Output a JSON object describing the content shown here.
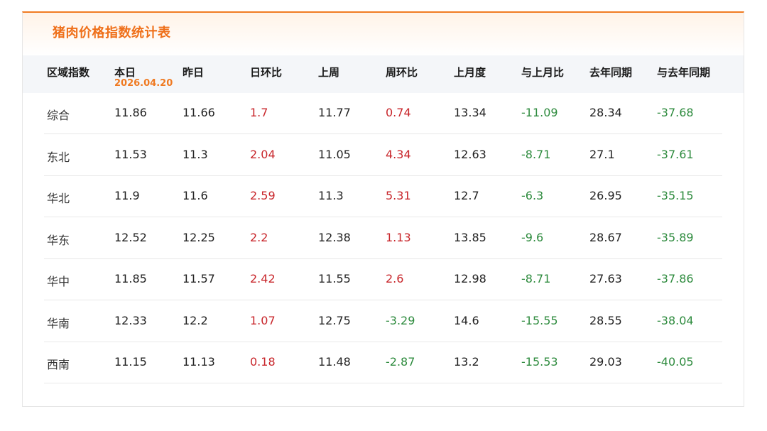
{
  "title": "猪肉价格指数统计表",
  "header": {
    "region": "区域指数",
    "today": "本日",
    "today_date": "2026.04.20",
    "yesterday": "昨日",
    "day_ratio": "日环比",
    "last_week": "上周",
    "week_ratio": "周环比",
    "last_month": "上月度",
    "month_ratio": "与上月比",
    "last_year": "去年同期",
    "year_ratio": "与去年同期"
  },
  "rows": [
    {
      "region": "综合",
      "today": "11.86",
      "yesterday": "11.66",
      "day_ratio": "1.7",
      "last_week": "11.77",
      "week_ratio": "0.74",
      "last_month": "13.34",
      "month_ratio": "-11.09",
      "last_year": "28.34",
      "year_ratio": "-37.68"
    },
    {
      "region": "东北",
      "today": "11.53",
      "yesterday": "11.3",
      "day_ratio": "2.04",
      "last_week": "11.05",
      "week_ratio": "4.34",
      "last_month": "12.63",
      "month_ratio": "-8.71",
      "last_year": "27.1",
      "year_ratio": "-37.61"
    },
    {
      "region": "华北",
      "today": "11.9",
      "yesterday": "11.6",
      "day_ratio": "2.59",
      "last_week": "11.3",
      "week_ratio": "5.31",
      "last_month": "12.7",
      "month_ratio": "-6.3",
      "last_year": "26.95",
      "year_ratio": "-35.15"
    },
    {
      "region": "华东",
      "today": "12.52",
      "yesterday": "12.25",
      "day_ratio": "2.2",
      "last_week": "12.38",
      "week_ratio": "1.13",
      "last_month": "13.85",
      "month_ratio": "-9.6",
      "last_year": "28.67",
      "year_ratio": "-35.89"
    },
    {
      "region": "华中",
      "today": "11.85",
      "yesterday": "11.57",
      "day_ratio": "2.42",
      "last_week": "11.55",
      "week_ratio": "2.6",
      "last_month": "12.98",
      "month_ratio": "-8.71",
      "last_year": "27.63",
      "year_ratio": "-37.86"
    },
    {
      "region": "华南",
      "today": "12.33",
      "yesterday": "12.2",
      "day_ratio": "1.07",
      "last_week": "12.75",
      "week_ratio": "-3.29",
      "last_month": "14.6",
      "month_ratio": "-15.55",
      "last_year": "28.55",
      "year_ratio": "-38.04"
    },
    {
      "region": "西南",
      "today": "11.15",
      "yesterday": "11.13",
      "day_ratio": "0.18",
      "last_week": "11.48",
      "week_ratio": "-2.87",
      "last_month": "13.2",
      "month_ratio": "-15.53",
      "last_year": "29.03",
      "year_ratio": "-40.05"
    }
  ],
  "colors": {
    "accent": "#ef6f19",
    "positive": "#c8262b",
    "negative": "#2e8b3e"
  }
}
